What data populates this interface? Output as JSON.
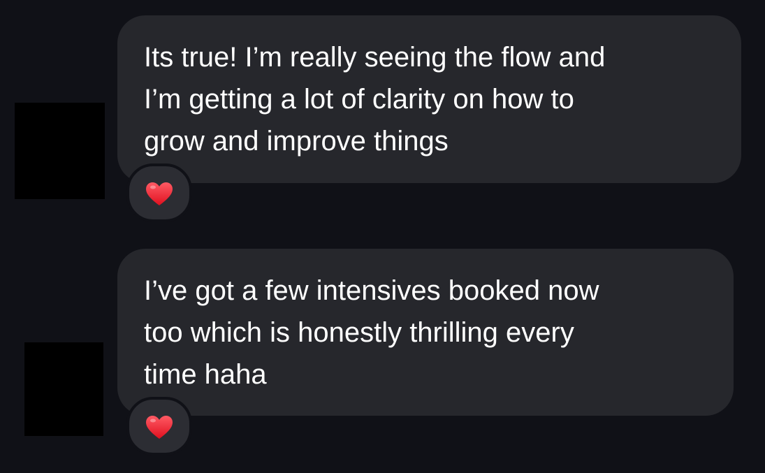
{
  "messages": [
    {
      "lines": [
        "Its true! I’m really seeing the flow and",
        "I’m getting a lot of clarity on how to",
        "grow and improve things"
      ],
      "reaction": "heart-icon",
      "reaction_color": "#ff2b3d"
    },
    {
      "lines": [
        "I’ve got a few intensives booked now",
        "too which is honestly thrilling every",
        "time haha"
      ],
      "reaction": "heart-icon",
      "reaction_color": "#ff2b3d"
    }
  ],
  "colors": {
    "background": "#101117",
    "bubble": "#26272c",
    "text": "#ffffff",
    "avatar_redaction": "#000000"
  }
}
